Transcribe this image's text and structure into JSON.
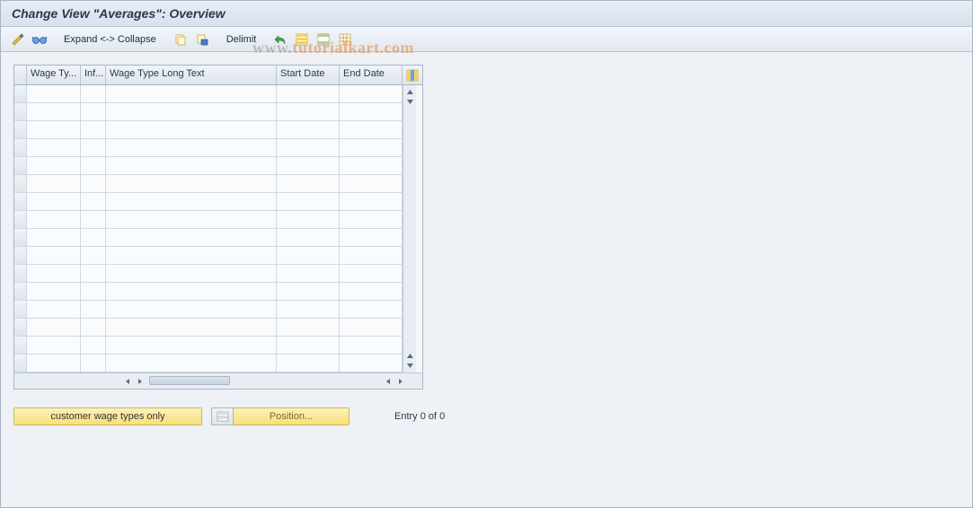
{
  "title": "Change View \"Averages\": Overview",
  "toolbar": {
    "expand_label": "Expand <-> Collapse",
    "delimit_label": "Delimit",
    "icons": {
      "change": "change-icon",
      "other": "glasses-icon",
      "copy": "copy-icon",
      "paste": "save-variant-icon",
      "undo": "undo-icon",
      "select_all": "select-all-icon",
      "deselect_all": "deselect-all-icon",
      "config": "settings-icon"
    }
  },
  "grid": {
    "columns": {
      "wage_type": "Wage Ty...",
      "inf": "Inf...",
      "wage_long": "Wage Type Long Text",
      "start": "Start Date",
      "end": "End Date"
    },
    "row_count": 16
  },
  "buttons": {
    "customer_wage": "customer wage types only",
    "position": "Position..."
  },
  "status": {
    "entry_text": "Entry 0 of 0"
  },
  "watermark": {
    "grey_part": "www.",
    "orange_part": "tutorialkart.com"
  }
}
